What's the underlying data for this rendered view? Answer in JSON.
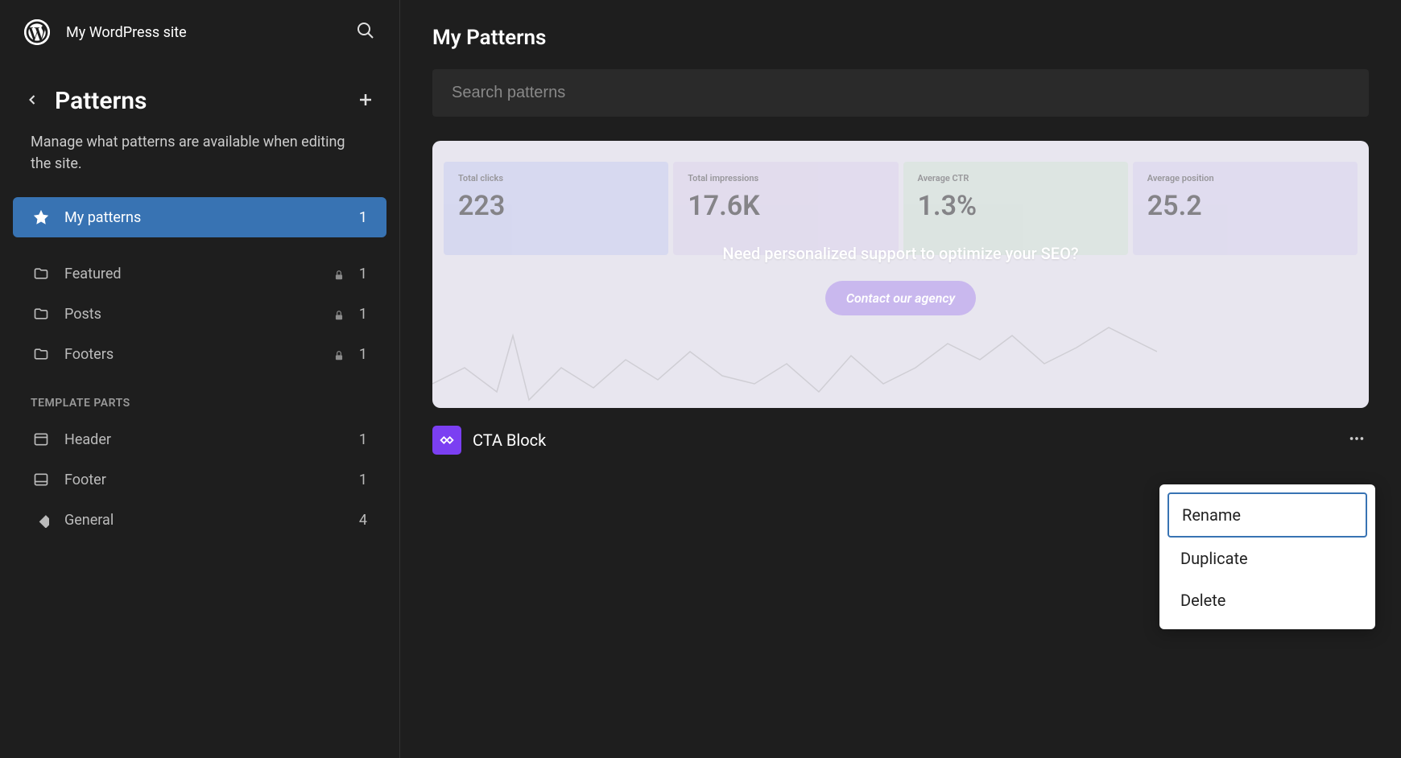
{
  "site_name": "My WordPress site",
  "sidebar": {
    "title": "Patterns",
    "description": "Manage what patterns are available when editing the site.",
    "my_patterns_label": "My patterns",
    "my_patterns_count": "1",
    "categories": [
      {
        "label": "Featured",
        "count": "1",
        "locked": true
      },
      {
        "label": "Posts",
        "count": "1",
        "locked": true
      },
      {
        "label": "Footers",
        "count": "1",
        "locked": true
      }
    ],
    "template_parts_heading": "TEMPLATE PARTS",
    "template_parts": [
      {
        "label": "Header",
        "count": "1"
      },
      {
        "label": "Footer",
        "count": "1"
      },
      {
        "label": "General",
        "count": "4"
      }
    ]
  },
  "main": {
    "title": "My Patterns",
    "search_placeholder": "Search patterns",
    "pattern": {
      "name": "CTA Block",
      "preview": {
        "question": "Need personalized support to optimize your SEO?",
        "cta_label": "Contact our agency",
        "stats": [
          {
            "label": "Total clicks",
            "value": "223"
          },
          {
            "label": "Total impressions",
            "value": "17.6K"
          },
          {
            "label": "Average CTR",
            "value": "1.3%"
          },
          {
            "label": "Average position",
            "value": "25.2"
          }
        ]
      }
    }
  },
  "dropdown": {
    "rename": "Rename",
    "duplicate": "Duplicate",
    "delete": "Delete"
  }
}
